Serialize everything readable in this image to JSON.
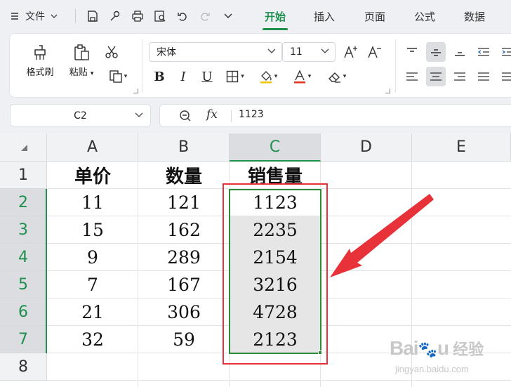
{
  "menubar": {
    "file_label": "文件",
    "tabs": [
      {
        "label": "开始",
        "active": true
      },
      {
        "label": "插入",
        "active": false
      },
      {
        "label": "页面",
        "active": false
      },
      {
        "label": "公式",
        "active": false
      },
      {
        "label": "数据",
        "active": false
      }
    ]
  },
  "ribbon": {
    "format_painter_label": "格式刷",
    "paste_label": "粘贴",
    "font_name": "宋体",
    "font_size": "11",
    "bold_label": "B",
    "italic_label": "I",
    "underline_label": "U"
  },
  "formula_bar": {
    "cell_ref": "C2",
    "fx_label": "fx",
    "value": "1123"
  },
  "sheet": {
    "columns": [
      "A",
      "B",
      "C",
      "D",
      "E"
    ],
    "selected_column": "C",
    "rows": [
      "1",
      "2",
      "3",
      "4",
      "5",
      "6",
      "7",
      "8"
    ],
    "header_row": [
      "单价",
      "数量",
      "销售量"
    ],
    "data_rows": [
      [
        "11",
        "121",
        "1123"
      ],
      [
        "15",
        "162",
        "2235"
      ],
      [
        "9",
        "289",
        "2154"
      ],
      [
        "7",
        "167",
        "3216"
      ],
      [
        "21",
        "306",
        "4728"
      ],
      [
        "32",
        "59",
        "2123"
      ]
    ]
  },
  "colors": {
    "accent": "#1f8f4e",
    "selection_border": "#2e8b3d",
    "annotation": "#e8323a"
  },
  "watermark": {
    "main": "Bai",
    "suffix": "u",
    "cn": "经验",
    "sub": "jingyan.baidu.com"
  }
}
